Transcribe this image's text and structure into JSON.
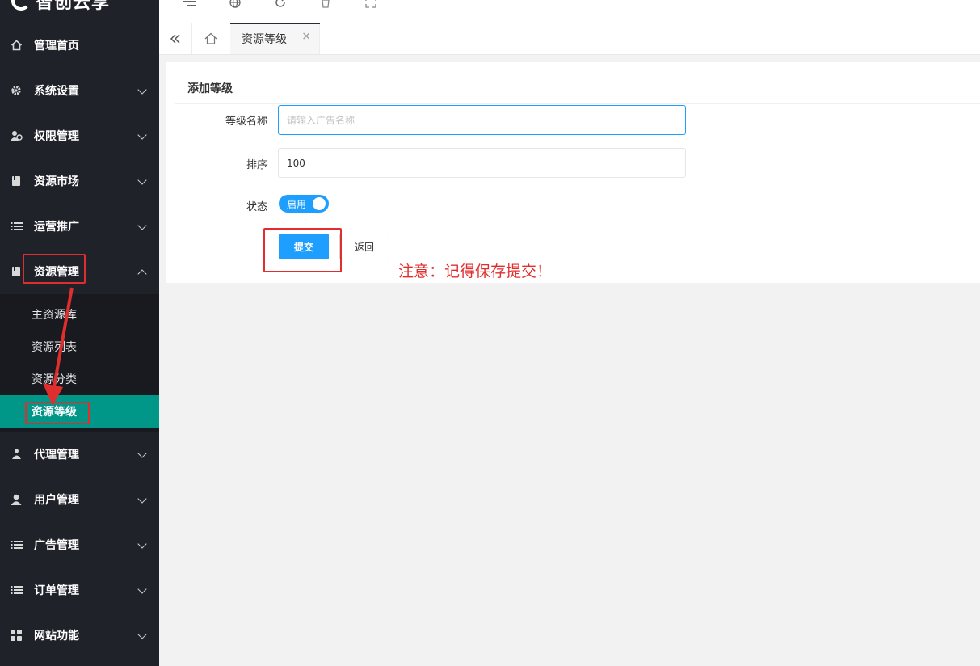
{
  "app": {
    "logo_text": "智创云享"
  },
  "sidebar": {
    "items": [
      {
        "label": "管理首页",
        "icon": "home-icon",
        "has_children": false
      },
      {
        "label": "系统设置",
        "icon": "gear-icon",
        "has_children": true
      },
      {
        "label": "权限管理",
        "icon": "users-icon",
        "has_children": true
      },
      {
        "label": "资源市场",
        "icon": "book-icon",
        "has_children": true
      },
      {
        "label": "运营推广",
        "icon": "list-icon",
        "has_children": true
      },
      {
        "label": "资源管理",
        "icon": "book-icon",
        "has_children": true,
        "expanded": true
      },
      {
        "label": "代理管理",
        "icon": "org-icon",
        "has_children": true
      },
      {
        "label": "用户管理",
        "icon": "user-icon",
        "has_children": true
      },
      {
        "label": "广告管理",
        "icon": "list-icon",
        "has_children": true
      },
      {
        "label": "订单管理",
        "icon": "list-icon",
        "has_children": true
      },
      {
        "label": "网站功能",
        "icon": "grid-icon",
        "has_children": true
      }
    ],
    "submenu": [
      {
        "label": "主资源库"
      },
      {
        "label": "资源列表"
      },
      {
        "label": "资源分类"
      },
      {
        "label": "资源等级",
        "active": true
      }
    ]
  },
  "header": {
    "icons": [
      "menu-toggle-icon",
      "globe-icon",
      "refresh-icon",
      "trash-icon",
      "fullscreen-icon"
    ]
  },
  "tabs": {
    "active_label": "资源等级",
    "close_symbol": "×"
  },
  "form": {
    "title": "添加等级",
    "name_label": "等级名称",
    "name_placeholder": "请输入广告名称",
    "name_value": "",
    "sort_label": "排序",
    "sort_value": "100",
    "status_label": "状态",
    "status_text": "启用",
    "status_on": true,
    "submit_label": "提交",
    "back_label": "返回"
  },
  "annotation": {
    "note": "注意：记得保存提交！"
  },
  "colors": {
    "sidebar_bg": "#20222a",
    "active_menu": "#009688",
    "primary": "#1e9fff",
    "annotation_red": "#e02e2e"
  }
}
